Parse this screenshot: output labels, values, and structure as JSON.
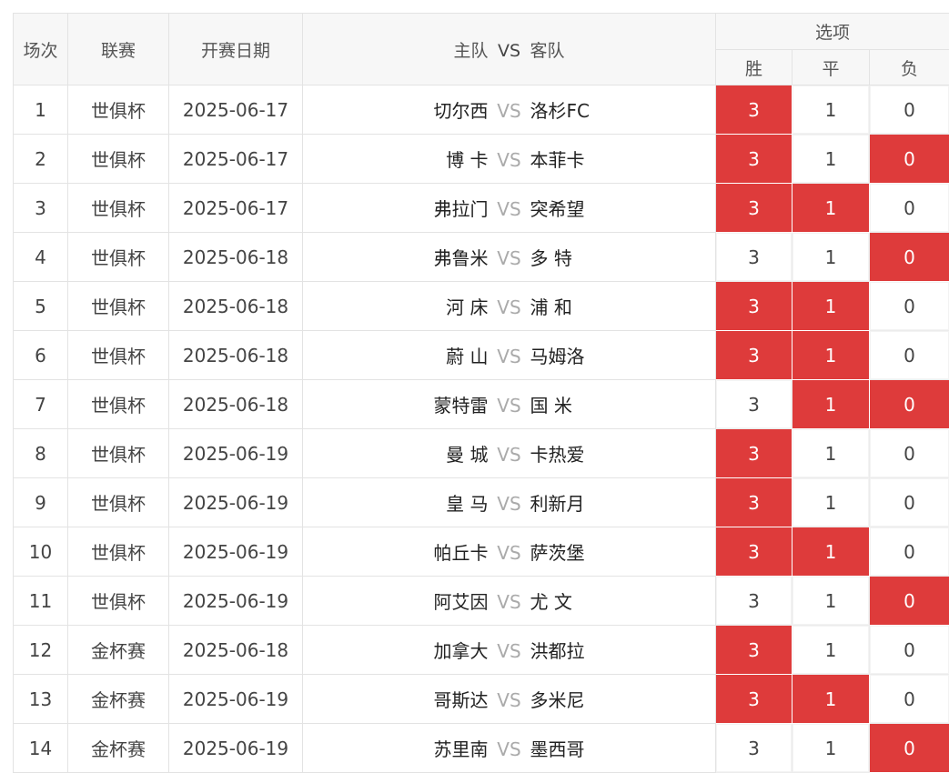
{
  "header": {
    "col_no": "场次",
    "col_league": "联赛",
    "col_date": "开赛日期",
    "col_home": "主队",
    "col_vs": "VS",
    "col_away": "客队",
    "col_options": "选项",
    "opt_win": "胜",
    "opt_draw": "平",
    "opt_lose": "负"
  },
  "rows": [
    {
      "no": "1",
      "league": "世俱杯",
      "date": "2025-06-17",
      "home": "切尔西",
      "vs": "VS",
      "away": "洛杉FC",
      "o3": "3",
      "o1": "1",
      "o0": "0",
      "sel": [
        true,
        false,
        false
      ]
    },
    {
      "no": "2",
      "league": "世俱杯",
      "date": "2025-06-17",
      "home": "博 卡",
      "vs": "VS",
      "away": "本菲卡",
      "o3": "3",
      "o1": "1",
      "o0": "0",
      "sel": [
        true,
        false,
        true
      ]
    },
    {
      "no": "3",
      "league": "世俱杯",
      "date": "2025-06-17",
      "home": "弗拉门",
      "vs": "VS",
      "away": "突希望",
      "o3": "3",
      "o1": "1",
      "o0": "0",
      "sel": [
        true,
        true,
        false
      ]
    },
    {
      "no": "4",
      "league": "世俱杯",
      "date": "2025-06-18",
      "home": "弗鲁米",
      "vs": "VS",
      "away": "多 特",
      "o3": "3",
      "o1": "1",
      "o0": "0",
      "sel": [
        false,
        false,
        true
      ]
    },
    {
      "no": "5",
      "league": "世俱杯",
      "date": "2025-06-18",
      "home": "河 床",
      "vs": "VS",
      "away": "浦 和",
      "o3": "3",
      "o1": "1",
      "o0": "0",
      "sel": [
        true,
        true,
        false
      ]
    },
    {
      "no": "6",
      "league": "世俱杯",
      "date": "2025-06-18",
      "home": "蔚 山",
      "vs": "VS",
      "away": "马姆洛",
      "o3": "3",
      "o1": "1",
      "o0": "0",
      "sel": [
        true,
        true,
        false
      ]
    },
    {
      "no": "7",
      "league": "世俱杯",
      "date": "2025-06-18",
      "home": "蒙特雷",
      "vs": "VS",
      "away": "国 米",
      "o3": "3",
      "o1": "1",
      "o0": "0",
      "sel": [
        false,
        true,
        true
      ]
    },
    {
      "no": "8",
      "league": "世俱杯",
      "date": "2025-06-19",
      "home": "曼 城",
      "vs": "VS",
      "away": "卡热爱",
      "o3": "3",
      "o1": "1",
      "o0": "0",
      "sel": [
        true,
        false,
        false
      ]
    },
    {
      "no": "9",
      "league": "世俱杯",
      "date": "2025-06-19",
      "home": "皇 马",
      "vs": "VS",
      "away": "利新月",
      "o3": "3",
      "o1": "1",
      "o0": "0",
      "sel": [
        true,
        false,
        false
      ]
    },
    {
      "no": "10",
      "league": "世俱杯",
      "date": "2025-06-19",
      "home": "帕丘卡",
      "vs": "VS",
      "away": "萨茨堡",
      "o3": "3",
      "o1": "1",
      "o0": "0",
      "sel": [
        true,
        true,
        false
      ]
    },
    {
      "no": "11",
      "league": "世俱杯",
      "date": "2025-06-19",
      "home": "阿艾因",
      "vs": "VS",
      "away": "尤 文",
      "o3": "3",
      "o1": "1",
      "o0": "0",
      "sel": [
        false,
        false,
        true
      ]
    },
    {
      "no": "12",
      "league": "金杯赛",
      "date": "2025-06-18",
      "home": "加拿大",
      "vs": "VS",
      "away": "洪都拉",
      "o3": "3",
      "o1": "1",
      "o0": "0",
      "sel": [
        true,
        false,
        false
      ]
    },
    {
      "no": "13",
      "league": "金杯赛",
      "date": "2025-06-19",
      "home": "哥斯达",
      "vs": "VS",
      "away": "多米尼",
      "o3": "3",
      "o1": "1",
      "o0": "0",
      "sel": [
        true,
        true,
        false
      ]
    },
    {
      "no": "14",
      "league": "金杯赛",
      "date": "2025-06-19",
      "home": "苏里南",
      "vs": "VS",
      "away": "墨西哥",
      "o3": "3",
      "o1": "1",
      "o0": "0",
      "sel": [
        false,
        false,
        true
      ]
    }
  ],
  "colors": {
    "selected": "#de3b3b",
    "header_bg": "#f7f7f7",
    "border": "#e3e3e3"
  }
}
